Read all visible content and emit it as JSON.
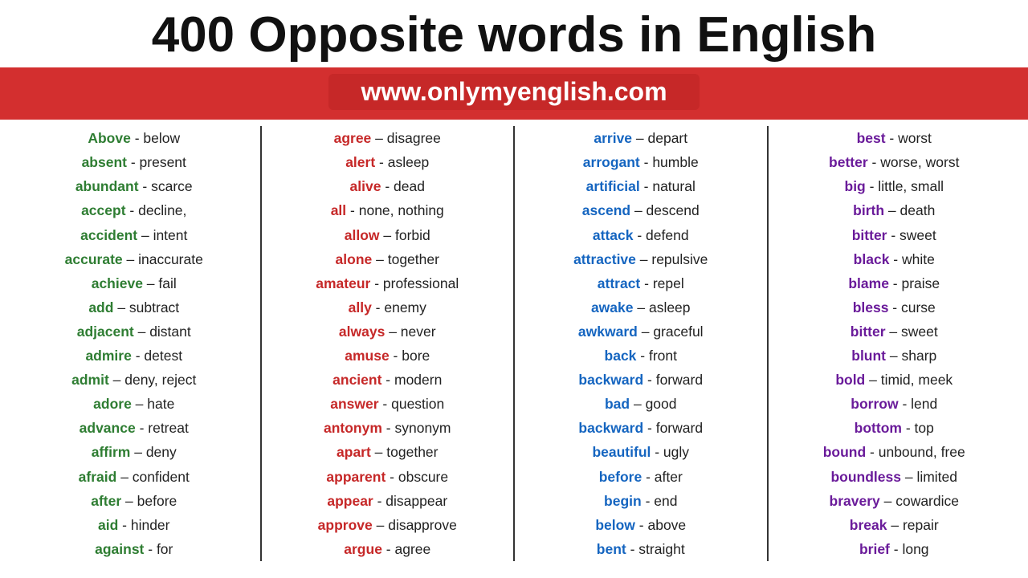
{
  "header": {
    "title": "400 Opposite words in English",
    "url": "www.onlymyenglish.com"
  },
  "columns": [
    {
      "id": "col1",
      "items": [
        {
          "key": "Above",
          "key_color": "green",
          "sep": "-",
          "val": "below"
        },
        {
          "key": "absent",
          "key_color": "green",
          "sep": "-",
          "val": "present"
        },
        {
          "key": "abundant",
          "key_color": "green",
          "sep": "-",
          "val": "scarce"
        },
        {
          "key": "accept",
          "key_color": "green",
          "sep": "-",
          "val": "decline,"
        },
        {
          "key": "accident",
          "key_color": "green",
          "sep": "–",
          "val": "intent"
        },
        {
          "key": "accurate",
          "key_color": "green",
          "sep": "–",
          "val": "inaccurate"
        },
        {
          "key": "achieve",
          "key_color": "green",
          "sep": "–",
          "val": "fail"
        },
        {
          "key": "add",
          "key_color": "green",
          "sep": "–",
          "val": "subtract"
        },
        {
          "key": "adjacent",
          "key_color": "green",
          "sep": "–",
          "val": "distant"
        },
        {
          "key": "admire",
          "key_color": "green",
          "sep": "-",
          "val": "detest"
        },
        {
          "key": "admit",
          "key_color": "green",
          "sep": "–",
          "val": "deny, reject"
        },
        {
          "key": "adore",
          "key_color": "green",
          "sep": "–",
          "val": "hate"
        },
        {
          "key": "advance",
          "key_color": "green",
          "sep": "-",
          "val": "retreat"
        },
        {
          "key": "affirm",
          "key_color": "green",
          "sep": "–",
          "val": "deny"
        },
        {
          "key": "afraid",
          "key_color": "green",
          "sep": "–",
          "val": "confident"
        },
        {
          "key": "after",
          "key_color": "green",
          "sep": "–",
          "val": "before"
        },
        {
          "key": "aid",
          "key_color": "green",
          "sep": "-",
          "val": "hinder"
        },
        {
          "key": "against",
          "key_color": "green",
          "sep": "-",
          "val": "for"
        }
      ]
    },
    {
      "id": "col2",
      "items": [
        {
          "key": "agree",
          "key_color": "red",
          "sep": "–",
          "val": "disagree"
        },
        {
          "key": "alert",
          "key_color": "red",
          "sep": "-",
          "val": "asleep"
        },
        {
          "key": "alive",
          "key_color": "red",
          "sep": "-",
          "val": "dead"
        },
        {
          "key": "all",
          "key_color": "red",
          "sep": "-",
          "val": "none, nothing"
        },
        {
          "key": "allow",
          "key_color": "red",
          "sep": "–",
          "val": "forbid"
        },
        {
          "key": "alone",
          "key_color": "red",
          "sep": "–",
          "val": "together"
        },
        {
          "key": "amateur",
          "key_color": "red",
          "sep": "-",
          "val": "professional"
        },
        {
          "key": "ally",
          "key_color": "red",
          "sep": "-",
          "val": "enemy"
        },
        {
          "key": "always",
          "key_color": "red",
          "sep": "–",
          "val": "never"
        },
        {
          "key": "amuse",
          "key_color": "red",
          "sep": "-",
          "val": "bore"
        },
        {
          "key": "ancient",
          "key_color": "red",
          "sep": "-",
          "val": "modern"
        },
        {
          "key": "answer",
          "key_color": "red",
          "sep": "-",
          "val": "question"
        },
        {
          "key": "antonym",
          "key_color": "red",
          "sep": "-",
          "val": "synonym"
        },
        {
          "key": "apart",
          "key_color": "red",
          "sep": "–",
          "val": "together"
        },
        {
          "key": "apparent",
          "key_color": "red",
          "sep": "-",
          "val": "obscure"
        },
        {
          "key": "appear",
          "key_color": "red",
          "sep": "-",
          "val": "disappear"
        },
        {
          "key": "approve",
          "key_color": "red",
          "sep": "–",
          "val": "disapprove"
        },
        {
          "key": "argue",
          "key_color": "red",
          "sep": "-",
          "val": "agree"
        }
      ]
    },
    {
      "id": "col3",
      "items": [
        {
          "key": "arrive",
          "key_color": "blue",
          "sep": "–",
          "val": "depart"
        },
        {
          "key": "arrogant",
          "key_color": "blue",
          "sep": "-",
          "val": "humble"
        },
        {
          "key": "artificial",
          "key_color": "blue",
          "sep": "-",
          "val": "natural"
        },
        {
          "key": "ascend",
          "key_color": "blue",
          "sep": "–",
          "val": "descend"
        },
        {
          "key": "attack",
          "key_color": "blue",
          "sep": "-",
          "val": "defend"
        },
        {
          "key": "attractive",
          "key_color": "blue",
          "sep": "–",
          "val": "repulsive"
        },
        {
          "key": "attract",
          "key_color": "blue",
          "sep": "-",
          "val": "repel"
        },
        {
          "key": "awake",
          "key_color": "blue",
          "sep": "–",
          "val": "asleep"
        },
        {
          "key": "awkward",
          "key_color": "blue",
          "sep": "–",
          "val": "graceful"
        },
        {
          "key": "back",
          "key_color": "blue",
          "sep": "-",
          "val": "front"
        },
        {
          "key": "backward",
          "key_color": "blue",
          "sep": "-",
          "val": "forward"
        },
        {
          "key": "bad",
          "key_color": "blue",
          "sep": "–",
          "val": "good"
        },
        {
          "key": "backward",
          "key_color": "blue",
          "sep": "-",
          "val": "forward"
        },
        {
          "key": "beautiful",
          "key_color": "blue",
          "sep": "-",
          "val": "ugly"
        },
        {
          "key": "before",
          "key_color": "blue",
          "sep": "-",
          "val": "after"
        },
        {
          "key": "begin",
          "key_color": "blue",
          "sep": "-",
          "val": "end"
        },
        {
          "key": "below",
          "key_color": "blue",
          "sep": "-",
          "val": "above"
        },
        {
          "key": "bent",
          "key_color": "blue",
          "sep": "-",
          "val": "straight"
        }
      ]
    },
    {
      "id": "col4",
      "items": [
        {
          "key": "best",
          "key_color": "purple",
          "sep": "-",
          "val": "worst"
        },
        {
          "key": "better",
          "key_color": "purple",
          "sep": "-",
          "val": "worse, worst"
        },
        {
          "key": "big",
          "key_color": "purple",
          "sep": "-",
          "val": "little, small"
        },
        {
          "key": "birth",
          "key_color": "purple",
          "sep": "–",
          "val": "death"
        },
        {
          "key": "bitter",
          "key_color": "purple",
          "sep": "-",
          "val": "sweet"
        },
        {
          "key": "black",
          "key_color": "purple",
          "sep": "-",
          "val": "white"
        },
        {
          "key": "blame",
          "key_color": "purple",
          "sep": "-",
          "val": "praise"
        },
        {
          "key": "bless",
          "key_color": "purple",
          "sep": "-",
          "val": "curse"
        },
        {
          "key": "bitter",
          "key_color": "purple",
          "sep": "–",
          "val": "sweet"
        },
        {
          "key": "blunt",
          "key_color": "purple",
          "sep": "–",
          "val": "sharp"
        },
        {
          "key": "bold",
          "key_color": "purple",
          "sep": "–",
          "val": "timid, meek"
        },
        {
          "key": "borrow",
          "key_color": "purple",
          "sep": "-",
          "val": "lend"
        },
        {
          "key": "bottom",
          "key_color": "purple",
          "sep": "-",
          "val": "top"
        },
        {
          "key": "bound",
          "key_color": "purple",
          "sep": "-",
          "val": "unbound, free"
        },
        {
          "key": "boundless",
          "key_color": "purple",
          "sep": "–",
          "val": "limited"
        },
        {
          "key": "bravery",
          "key_color": "purple",
          "sep": "–",
          "val": "cowardice"
        },
        {
          "key": "break",
          "key_color": "purple",
          "sep": "–",
          "val": "repair"
        },
        {
          "key": "brief",
          "key_color": "purple",
          "sep": "-",
          "val": "long"
        }
      ]
    }
  ]
}
